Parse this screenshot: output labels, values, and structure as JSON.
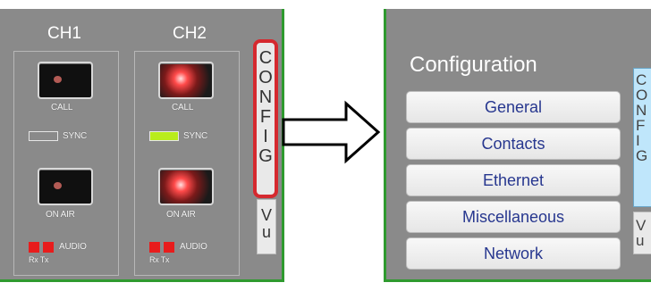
{
  "left_panel": {
    "channels": [
      {
        "title": "CH1",
        "call_label": "CALL",
        "sync_label": "SYNC",
        "sync_color": "#8a8a8a",
        "onair_label": "ON AIR",
        "audio_label": "AUDIO",
        "rxtx_label": "Rx Tx",
        "call_lit": false,
        "onair_lit": false
      },
      {
        "title": "CH2",
        "call_label": "CALL",
        "sync_label": "SYNC",
        "sync_color": "#b9ec1d",
        "onair_label": "ON AIR",
        "audio_label": "AUDIO",
        "rxtx_label": "Rx Tx",
        "call_lit": true,
        "onair_lit": true
      }
    ],
    "config_tab_letters": [
      "C",
      "O",
      "N",
      "F",
      "I",
      "G"
    ],
    "vu_tab_letters": [
      "V",
      "u"
    ],
    "highlight_color": "#d5292f"
  },
  "right_panel": {
    "title": "Configuration",
    "menu": [
      "General",
      "Contacts",
      "Ethernet",
      "Miscellaneous",
      "Network"
    ],
    "config_tab_letters": [
      "C",
      "O",
      "N",
      "F",
      "I",
      "G"
    ],
    "vu_tab_letters": [
      "V",
      "u"
    ]
  },
  "colors": {
    "panel_bg": "#8a8a8a",
    "panel_border": "#2f9a2f",
    "menu_text": "#27378f",
    "audio_led": "#e81c1c"
  }
}
